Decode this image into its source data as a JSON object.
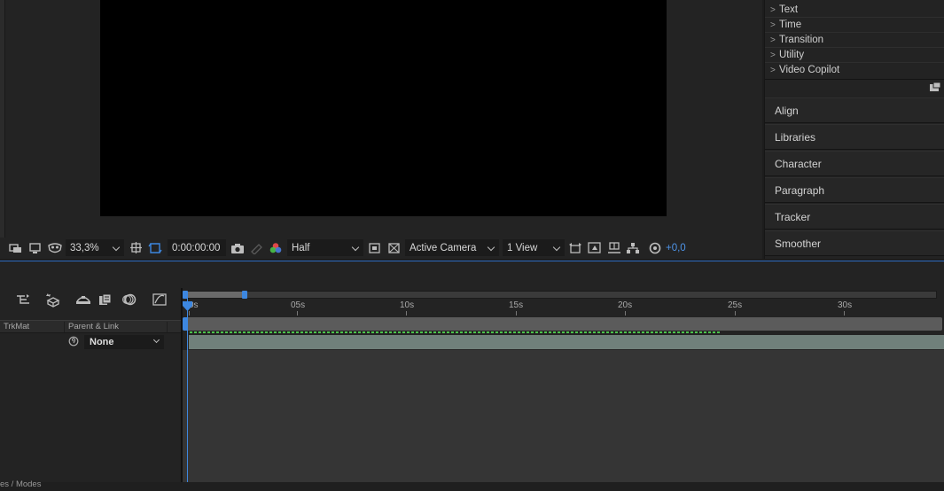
{
  "viewer": {
    "zoom": "33,3%",
    "timecode": "0:00:00:00",
    "resolution": "Half",
    "camera": "Active Camera",
    "views": "1 View",
    "exposure": "+0,0"
  },
  "effects_panel": {
    "categories": [
      "Text",
      "Time",
      "Transition",
      "Utility",
      "Video Copilot"
    ]
  },
  "panels": [
    "Align",
    "Libraries",
    "Character",
    "Paragraph",
    "Tracker",
    "Smoother"
  ],
  "timeline": {
    "columns": {
      "trkmat": "TrkMat",
      "parent": "Parent & Link"
    },
    "parent_value": "None",
    "ruler": [
      "0s",
      "05s",
      "10s",
      "15s",
      "20s",
      "25s",
      "30s"
    ],
    "bottom_label": "es / Modes"
  },
  "colors": {
    "accent": "#3d87e0",
    "cache": "#4cc24c",
    "layer_bar": "#70807b"
  }
}
